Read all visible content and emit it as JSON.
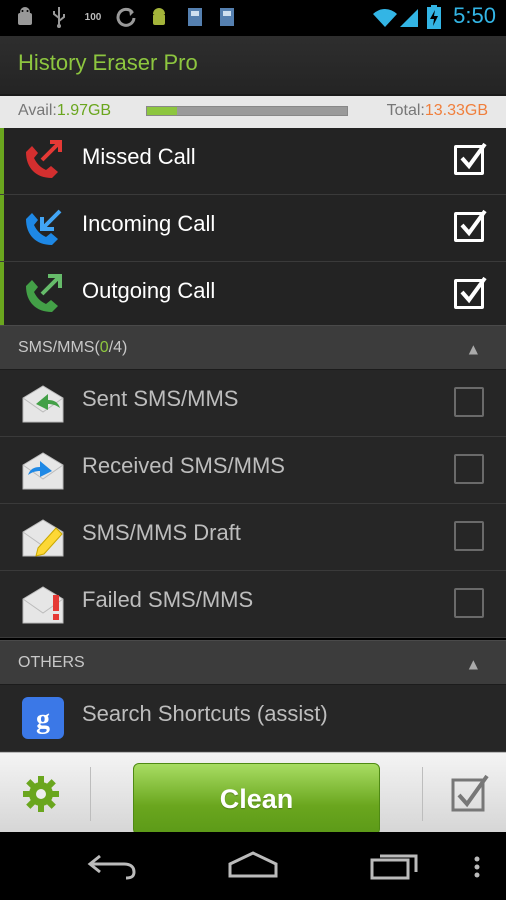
{
  "status_bar": {
    "time": "5:50",
    "battery_label": "100",
    "icons": [
      "android-debug-icon",
      "usb-icon",
      "battery-100-icon",
      "sync-icon",
      "android-icon",
      "sd-card-icon",
      "sd-card-icon",
      "wifi-icon",
      "signal-icon",
      "battery-charging-icon"
    ]
  },
  "app": {
    "title": "History Eraser Pro",
    "accent_color": "#8dc63f"
  },
  "storage": {
    "avail_label": "Avail:",
    "avail_value": "1.97GB",
    "total_label": "Total:",
    "total_value": "13.33GB",
    "used_fraction": 0.15
  },
  "call_items": [
    {
      "label": "Missed Call",
      "icon": "missed-call-icon",
      "checked": true
    },
    {
      "label": "Incoming Call",
      "icon": "incoming-call-icon",
      "checked": true
    },
    {
      "label": "Outgoing Call",
      "icon": "outgoing-call-icon",
      "checked": true
    }
  ],
  "sms_section": {
    "title_prefix": "SMS/MMS(",
    "selected": "0",
    "title_suffix": "/4)"
  },
  "sms_items": [
    {
      "label": "Sent SMS/MMS",
      "icon": "sent-mail-icon",
      "checked": false
    },
    {
      "label": "Received SMS/MMS",
      "icon": "received-mail-icon",
      "checked": false
    },
    {
      "label": "SMS/MMS Draft",
      "icon": "draft-mail-icon",
      "checked": false
    },
    {
      "label": "Failed SMS/MMS",
      "icon": "failed-mail-icon",
      "checked": false
    }
  ],
  "others_section": {
    "title": "OTHERS"
  },
  "others_items": [
    {
      "label": "Search Shortcuts (assist)",
      "icon": "google-search-icon"
    }
  ],
  "toolbar": {
    "clean_label": "Clean"
  }
}
